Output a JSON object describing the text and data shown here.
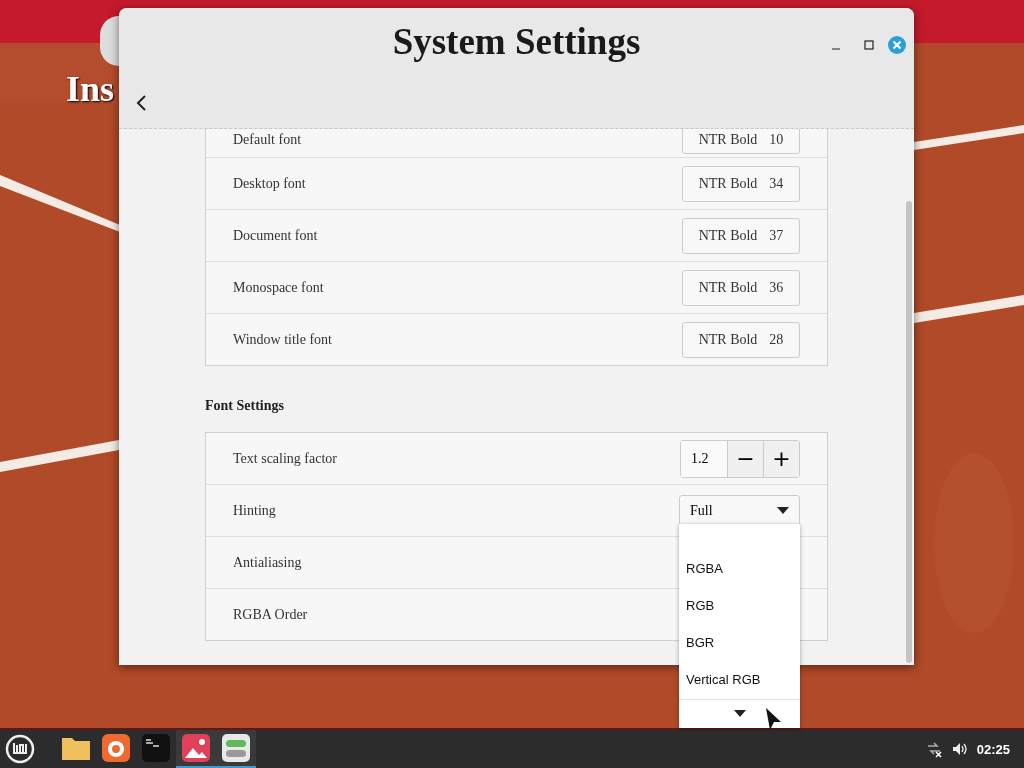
{
  "desktop": {
    "icon_label": "Ins"
  },
  "window": {
    "title": "System Settings",
    "font_rows": [
      {
        "label": "Default font",
        "font": "NTR Bold",
        "size": "10"
      },
      {
        "label": "Desktop font",
        "font": "NTR Bold",
        "size": "34"
      },
      {
        "label": "Document font",
        "font": "NTR Bold",
        "size": "37"
      },
      {
        "label": "Monospace font",
        "font": "NTR Bold",
        "size": "36"
      },
      {
        "label": "Window title font",
        "font": "NTR Bold",
        "size": "28"
      }
    ],
    "section_title": "Font Settings",
    "settings_rows": [
      {
        "label": "Text scaling factor",
        "kind": "spin",
        "value": "1.2",
        "minus": "−",
        "plus": "+"
      },
      {
        "label": "Hinting",
        "kind": "dropdown",
        "value": "Full"
      },
      {
        "label": "Antialiasing",
        "kind": "plain"
      },
      {
        "label": "RGBA Order",
        "kind": "plain"
      }
    ]
  },
  "popup": {
    "items": [
      "RGBA",
      "RGB",
      "BGR",
      "Vertical RGB"
    ]
  },
  "taskbar": {
    "apps": [
      {
        "kind": "folder",
        "running": false
      },
      {
        "kind": "browser",
        "running": false
      },
      {
        "kind": "terminal",
        "running": false
      },
      {
        "kind": "photos",
        "running": true
      },
      {
        "kind": "settings",
        "running": true
      }
    ],
    "clock": "02:25"
  }
}
